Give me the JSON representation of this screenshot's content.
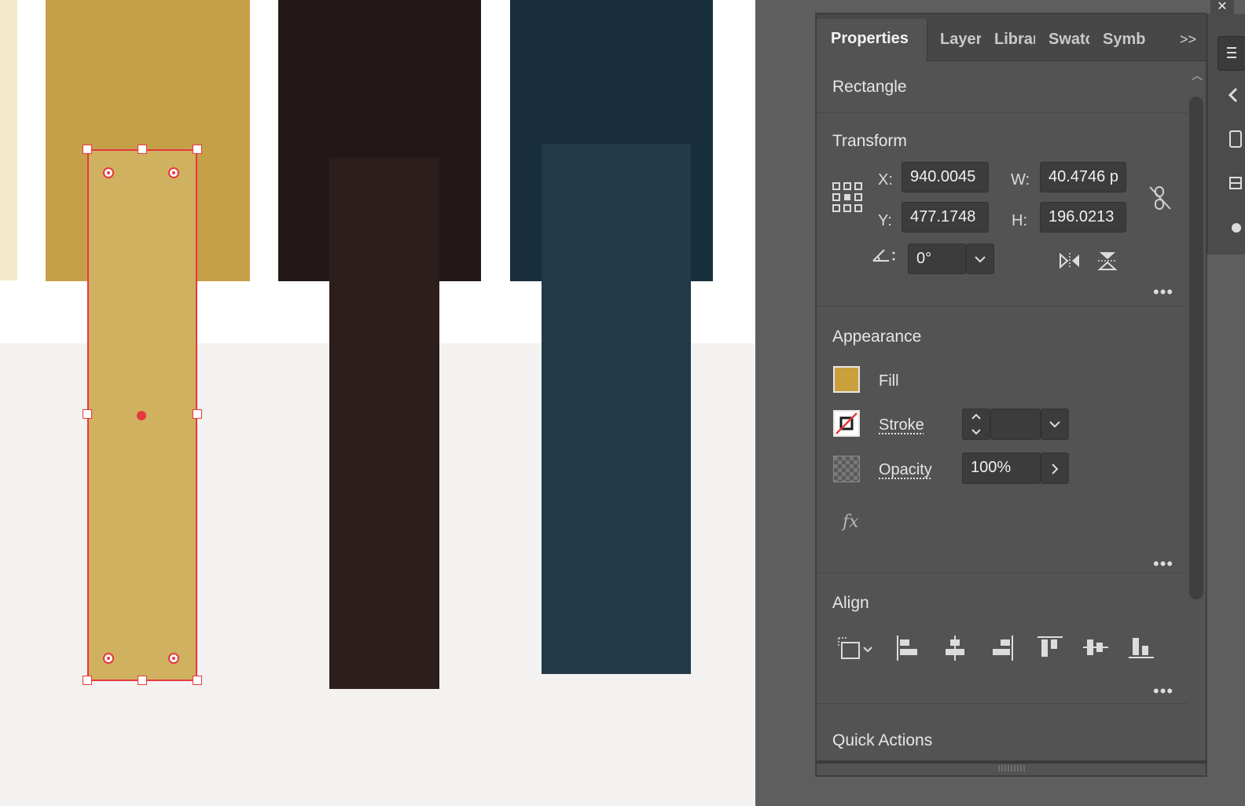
{
  "window": {
    "close_glyph": "✕"
  },
  "canvas": {
    "colors": {
      "cream": "#f5e9cc",
      "gold": "#c6a049",
      "gold_light": "#cfb160",
      "dark_brown": "#231817",
      "brown": "#2c1e1c",
      "navy": "#182e3d",
      "teal_navy": "#213a4a",
      "selection": "#e8383d"
    }
  },
  "panel": {
    "tabs": [
      {
        "label": "Properties",
        "active": true
      },
      {
        "label": "Layers"
      },
      {
        "label": "Libraries"
      },
      {
        "label": "Swatches"
      },
      {
        "label": "Symbols"
      }
    ],
    "more_glyph": ">>",
    "object_type": "Rectangle",
    "transform": {
      "title": "Transform",
      "x_label": "X:",
      "x_value": "940.0045",
      "y_label": "Y:",
      "y_value": "477.1748",
      "w_label": "W:",
      "w_value": "40.4746 p",
      "h_label": "H:",
      "h_value": "196.0213",
      "rotate_value": "0°",
      "more": "•••"
    },
    "appearance": {
      "title": "Appearance",
      "fill_label": "Fill",
      "fill_color": "#c9a03c",
      "stroke_label": "Stroke",
      "opacity_label": "Opacity",
      "opacity_value": "100%",
      "fx_label": "fx",
      "more": "•••"
    },
    "align": {
      "title": "Align",
      "more": "•••"
    },
    "quick_actions": {
      "title": "Quick Actions"
    }
  }
}
